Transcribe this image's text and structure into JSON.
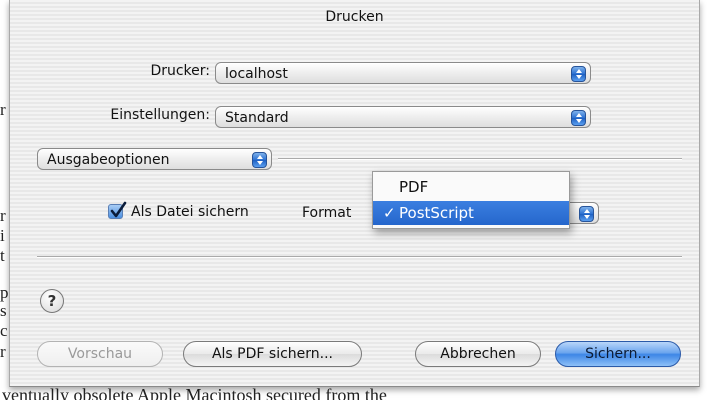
{
  "dialog": {
    "title": "Drucken"
  },
  "printer": {
    "label": "Drucker:",
    "value": "localhost"
  },
  "presets": {
    "label": "Einstellungen:",
    "value": "Standard"
  },
  "panel": {
    "value": "Ausgabeoptionen"
  },
  "save_as_file": {
    "label": "Als Datei sichern",
    "checked": true
  },
  "format": {
    "label": "Format",
    "options": [
      "PDF",
      "PostScript"
    ],
    "selected": "PostScript",
    "check_mark": "✓"
  },
  "help": {
    "glyph": "?"
  },
  "buttons": {
    "preview": "Vorschau",
    "save_pdf": "Als PDF sichern...",
    "cancel": "Abbrechen",
    "save": "Sichern..."
  },
  "background_doc": {
    "margin_chars": [
      "r",
      "r",
      "i",
      "t",
      "p",
      "s",
      "c",
      "r"
    ],
    "bottom_line": "ventually obsolete Apple Macintosh secured from the"
  },
  "colors": {
    "selection": "#2566cc",
    "default_button": "#3d86e6",
    "stepper": "#2a6fd1"
  }
}
